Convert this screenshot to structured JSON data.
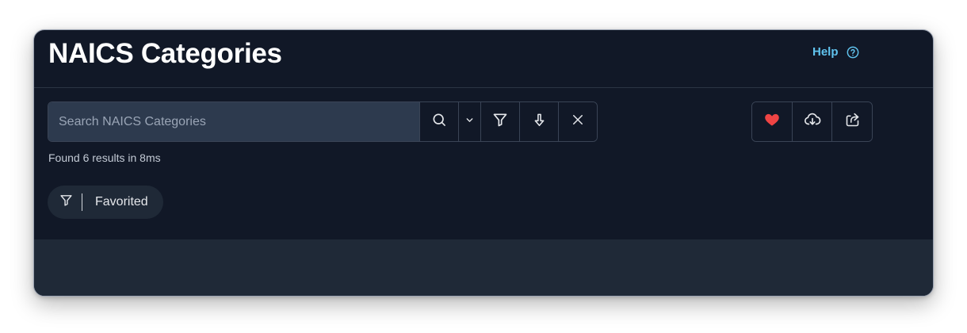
{
  "header": {
    "title": "NAICS Categories",
    "help_label": "Help"
  },
  "search": {
    "placeholder": "Search NAICS Categories",
    "value": "",
    "icons": [
      "search-icon",
      "chevron-down-icon",
      "filter-icon",
      "arrow-down-icon",
      "close-icon"
    ]
  },
  "actions": {
    "icons": [
      "heart-icon",
      "cloud-download-icon",
      "share-icon"
    ],
    "heart_color": "#ef4444"
  },
  "status": {
    "results_text": "Found 6 results in 8ms"
  },
  "filters": {
    "chip_label": "Favorited",
    "chip_icon": "filter-icon"
  },
  "colors": {
    "background": "#111827",
    "accent": "#60c3ee",
    "panel": "#1f2937"
  }
}
